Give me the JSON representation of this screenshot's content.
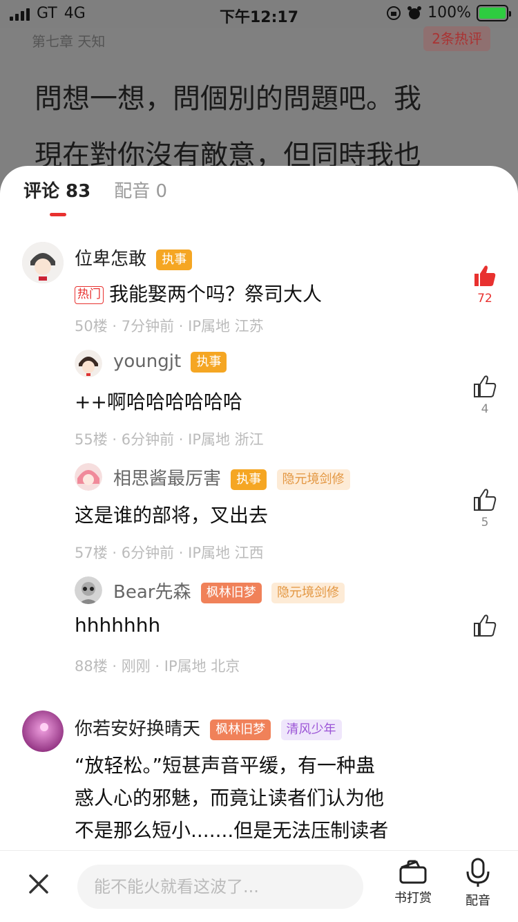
{
  "status": {
    "carrier": "GT",
    "network": "4G",
    "time": "下午12:17",
    "battery_pct": "100%",
    "battery_level": 1.0
  },
  "reader": {
    "chapter": "第七章 天知",
    "hot_chip": "2条热评",
    "line1": "問想一想，問個別的問題吧。我",
    "line2": "現在對你沒有敵意，但同時我也"
  },
  "tabs": [
    {
      "label": "评论 83"
    },
    {
      "label": "配音 0"
    }
  ],
  "comments": [
    {
      "name": "位卑怎敢",
      "badges": [
        "执事"
      ],
      "hot_tag": "热门",
      "text": "我能娶两个吗？祭司大人",
      "meta": "50楼 · 7分钟前 · IP属地 江苏",
      "likes": "72"
    },
    {
      "name": "youngjt",
      "badges": [
        "执事"
      ],
      "text": "++啊哈哈哈哈哈哈",
      "meta": "55楼 · 6分钟前 · IP属地 浙江",
      "likes": "4"
    },
    {
      "name": "相思酱最厉害",
      "badges": [
        "执事",
        "隐元境剑修"
      ],
      "text": "这是谁的部将，叉出去",
      "meta": "57楼 · 6分钟前 · IP属地 江西",
      "likes": "5"
    },
    {
      "name": "Bear先森",
      "badges": [
        "枫林旧梦",
        "隐元境剑修"
      ],
      "text": "hhhhhhh",
      "meta": "88楼 · 刚刚 · IP属地 北京",
      "likes": ""
    },
    {
      "name": "你若安好换晴天",
      "badges": [
        "枫林旧梦",
        "清风少年"
      ],
      "text_lines": [
        "“放轻松。”短甚声音平缓，有一种蛊",
        "惑人心的邪魅，而竟让读者们认为他",
        "不是那么短小.......但是无法压制读者"
      ]
    }
  ],
  "bottom": {
    "placeholder": "能不能火就看这波了...",
    "reward_label": "书打赏",
    "dub_label": "配音"
  },
  "colors": {
    "accent_red": "#e8312f",
    "badge_orange": "#f5a623",
    "badge_red": "#f08159",
    "badge_peach": "#fdebd6",
    "badge_purple": "#efe6fb"
  },
  "icons": {
    "close": "close-icon",
    "like": "thumbs-up-icon",
    "reward": "wallet-icon",
    "dub": "microphone-icon"
  }
}
